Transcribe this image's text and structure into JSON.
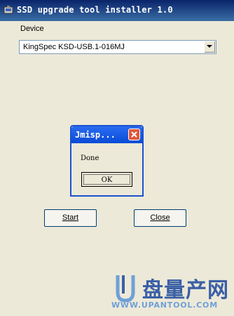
{
  "window": {
    "title": "SSD upgrade tool installer 1.0",
    "icon": "app-icon"
  },
  "device": {
    "label": "Device",
    "selected": "KingSpec KSD-USB.1-016MJ"
  },
  "dialog": {
    "title": "Jmisp...",
    "message": "Done",
    "ok_label": "OK"
  },
  "buttons": {
    "start": "Start",
    "close": "Close"
  },
  "watermark": {
    "name": "盘量产网",
    "url": "WWW.UPANTOOL.COM"
  },
  "colors": {
    "titlebar": "#0a246a",
    "dialog_title": "#0a4bd6",
    "close_button": "#e0573a",
    "watermark": "#3a5fa6"
  }
}
